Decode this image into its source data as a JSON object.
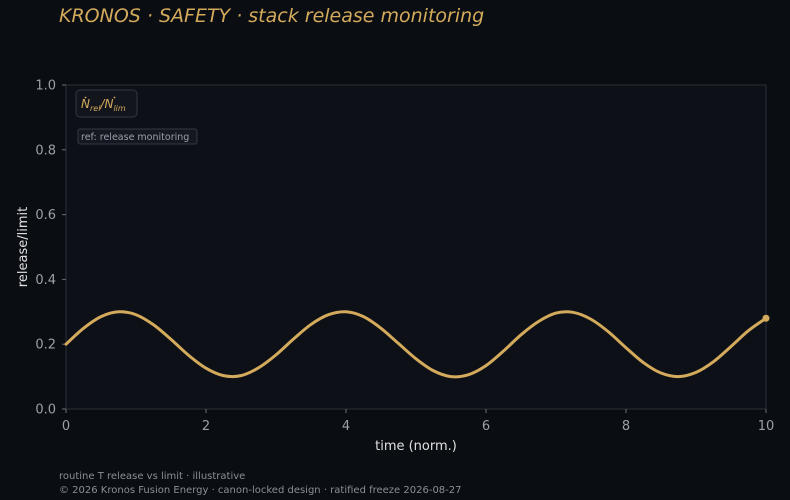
{
  "header": {
    "title": "KRONOS · SAFETY  ·  stack release monitoring"
  },
  "chart_data": {
    "type": "line",
    "xlabel": "time (norm.)",
    "ylabel": "release/limit",
    "xlim": [
      0,
      10
    ],
    "ylim": [
      0,
      1
    ],
    "xticks": [
      0,
      2,
      4,
      6,
      8,
      10
    ],
    "yticks": [
      0.0,
      0.2,
      0.4,
      0.6,
      0.8,
      1.0
    ],
    "ytick_labels": [
      "0.0",
      "0.2",
      "0.4",
      "0.6",
      "0.8",
      "1.0"
    ],
    "grid": false,
    "legend_position": "top-left",
    "series": [
      {
        "name": "Ṅrel/Ṅlim",
        "color": "#d4aa5c",
        "x": [
          0,
          0.25,
          0.5,
          0.75,
          1.0,
          1.25,
          1.5,
          1.75,
          2.0,
          2.25,
          2.5,
          2.75,
          3.0,
          3.25,
          3.5,
          3.75,
          4.0,
          4.25,
          4.5,
          4.75,
          5.0,
          5.25,
          5.5,
          5.75,
          6.0,
          6.25,
          6.5,
          6.75,
          7.0,
          7.25,
          7.5,
          7.75,
          8.0,
          8.25,
          8.5,
          8.75,
          9.0,
          9.25,
          9.5,
          9.75,
          10.0
        ],
        "y": [
          0.2,
          0.249,
          0.285,
          0.3,
          0.291,
          0.26,
          0.215,
          0.166,
          0.126,
          0.103,
          0.103,
          0.127,
          0.167,
          0.216,
          0.261,
          0.291,
          0.3,
          0.285,
          0.249,
          0.202,
          0.155,
          0.118,
          0.1,
          0.106,
          0.134,
          0.179,
          0.229,
          0.27,
          0.296,
          0.298,
          0.277,
          0.238,
          0.189,
          0.143,
          0.111,
          0.1,
          0.113,
          0.146,
          0.193,
          0.242,
          0.28
        ]
      }
    ],
    "annotation": "ref: release monitoring"
  },
  "footer": {
    "line1": "routine T release vs limit · illustrative",
    "line2": "© 2026 Kronos Fusion Energy · canon-locked design · ratified freeze 2026-08-27"
  },
  "colors": {
    "background": "#0a0d12",
    "plot_bg": "#0d1017",
    "accent": "#d4aa5c",
    "axis": "#3a3e45",
    "tick_text": "#9aa0a8"
  }
}
